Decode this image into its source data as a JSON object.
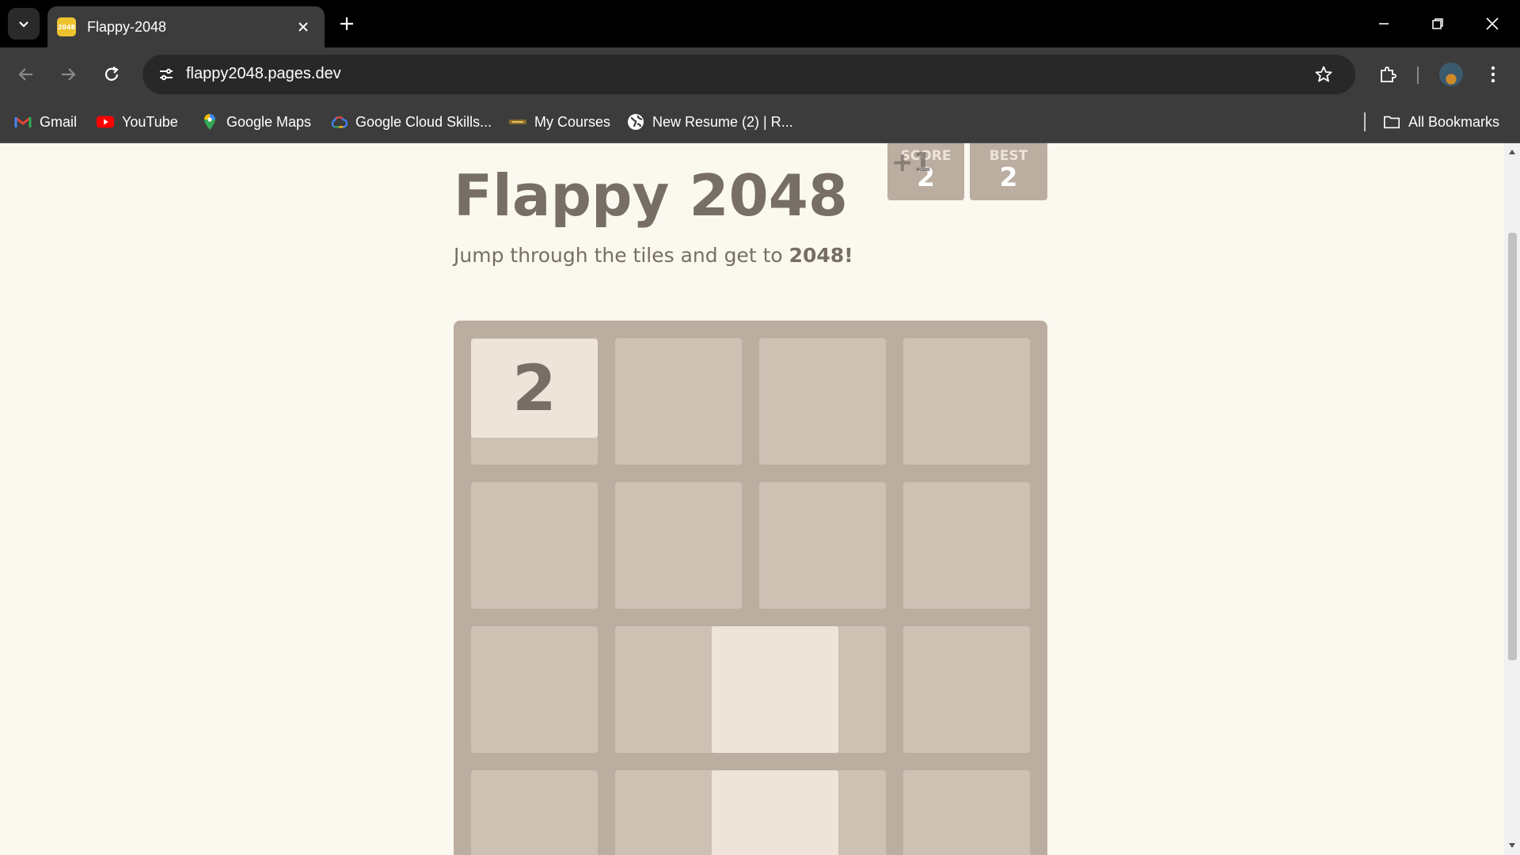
{
  "browser": {
    "tab_title": "Flappy-2048",
    "favicon_text": "2048",
    "url": "flappy2048.pages.dev",
    "bookmarks": [
      {
        "label": "Gmail",
        "icon": "gmail-icon"
      },
      {
        "label": "YouTube",
        "icon": "youtube-icon"
      },
      {
        "label": "Google Maps",
        "icon": "maps-icon"
      },
      {
        "label": "Google Cloud Skills...",
        "icon": "cloud-icon"
      },
      {
        "label": "My Courses",
        "icon": "courses-icon"
      },
      {
        "label": "New Resume (2) | R...",
        "icon": "globe-icon"
      }
    ],
    "all_bookmarks_label": "All Bookmarks"
  },
  "game": {
    "title": "Flappy 2048",
    "subtitle_prefix": "Jump through the tiles and get to ",
    "subtitle_bold": "2048!",
    "score_label": "SCORE",
    "score_value": "2",
    "score_addition": "+1",
    "best_label": "BEST",
    "best_value": "2",
    "player_tile_value": "2"
  },
  "colors": {
    "page_background": "#faf8ef",
    "board": "#bbada0",
    "empty_cell": "#cdc1b4",
    "tile_2": "#eee4da",
    "text": "#776e65"
  }
}
